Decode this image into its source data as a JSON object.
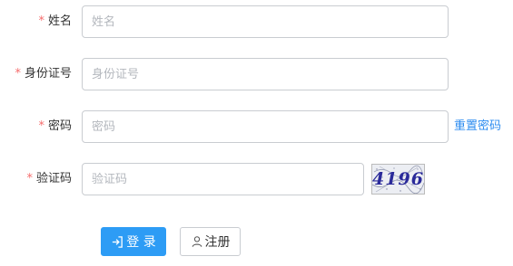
{
  "form": {
    "name": {
      "required_mark": "*",
      "label": "姓名",
      "placeholder": "姓名",
      "value": ""
    },
    "id_number": {
      "required_mark": "*",
      "label": "身份证号",
      "placeholder": "身份证号",
      "value": ""
    },
    "password": {
      "required_mark": "*",
      "label": "密码",
      "placeholder": "密码",
      "value": "",
      "reset_link": "重置密码"
    },
    "captcha": {
      "required_mark": "*",
      "label": "验证码",
      "placeholder": "验证码",
      "value": "",
      "image_text": "4196"
    }
  },
  "actions": {
    "login_label": "登 录",
    "login_icon": "login-icon",
    "register_label": "注册",
    "register_icon": "user-icon"
  },
  "colors": {
    "required": "#f56c6c",
    "primary": "#2d9cf5",
    "link": "#2d8cf0",
    "border": "#c9ccd1"
  }
}
